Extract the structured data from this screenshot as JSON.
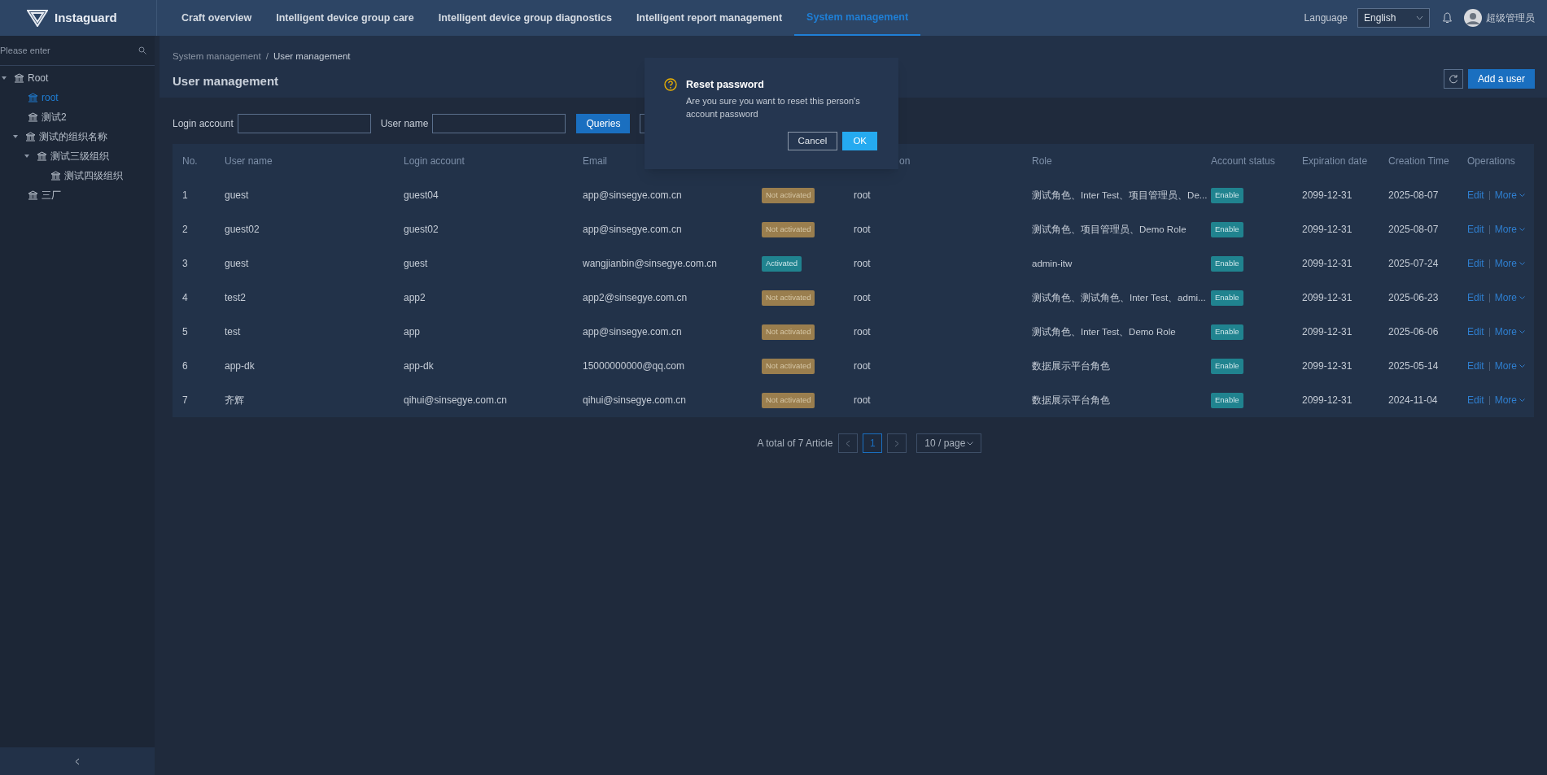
{
  "header": {
    "logo_text": "Instaguard",
    "nav": [
      {
        "label": "Craft overview",
        "selected": false
      },
      {
        "label": "Intelligent device group care",
        "selected": false
      },
      {
        "label": "Intelligent device group diagnostics",
        "selected": false
      },
      {
        "label": "Intelligent report management",
        "selected": false
      },
      {
        "label": "System management",
        "selected": true
      }
    ],
    "language_label": "Language",
    "language": "English",
    "user_name": "超级管理员"
  },
  "sidebar": {
    "search_placeholder": "Please enter",
    "tree": [
      {
        "label": "Root",
        "selected": false,
        "expanded": true,
        "children": [
          {
            "label": "root",
            "selected": true
          },
          {
            "label": "测试2",
            "selected": false
          },
          {
            "label": "测试的组织名称",
            "selected": false,
            "expanded": true,
            "children": [
              {
                "label": "测试三级组织",
                "selected": false,
                "expanded": true,
                "children": [
                  {
                    "label": "测试四级组织",
                    "selected": false
                  }
                ]
              }
            ]
          },
          {
            "label": "三厂",
            "selected": false
          }
        ]
      }
    ]
  },
  "breadcrumb": [
    "System management",
    "User management"
  ],
  "breadcrumb_separator": "/",
  "page_title": "User management",
  "add_button": "Add a user",
  "filters": [
    {
      "label": "Login account"
    },
    {
      "label": "User name"
    }
  ],
  "query_button": "Queries",
  "table": {
    "columns": [
      "No.",
      "User name",
      "Login account",
      "Email",
      "",
      "on",
      "Role",
      "Account status",
      "Expiration date",
      "Creation Time",
      "Operations"
    ],
    "rows": [
      {
        "no": "1",
        "user_name": "guest",
        "login": "guest04",
        "email": "app@sinsegye.com.cn",
        "activation": {
          "label": "Not activated",
          "kind": "inactive"
        },
        "org": "root",
        "role": "测试角色、Inter Test、项目管理员、De...",
        "account_status": "Enable",
        "expires": "2099-12-31",
        "created": "2025-08-07",
        "edit": "Edit",
        "more": "More"
      },
      {
        "no": "2",
        "user_name": "guest02",
        "login": "guest02",
        "email": "app@sinsegye.com.cn",
        "activation": {
          "label": "Not activated",
          "kind": "inactive"
        },
        "org": "root",
        "role": "测试角色、项目管理员、Demo Role",
        "account_status": "Enable",
        "expires": "2099-12-31",
        "created": "2025-08-07",
        "edit": "Edit",
        "more": "More"
      },
      {
        "no": "3",
        "user_name": "guest",
        "login": "guest",
        "email": "wangjianbin@sinsegye.com.cn",
        "activation": {
          "label": "Activated",
          "kind": "active"
        },
        "org": "root",
        "role": "admin-itw",
        "account_status": "Enable",
        "expires": "2099-12-31",
        "created": "2025-07-24",
        "edit": "Edit",
        "more": "More"
      },
      {
        "no": "4",
        "user_name": "test2",
        "login": "app2",
        "email": "app2@sinsegye.com.cn",
        "activation": {
          "label": "Not activated",
          "kind": "inactive"
        },
        "org": "root",
        "role": "测试角色、测试角色、Inter Test、admi...",
        "account_status": "Enable",
        "expires": "2099-12-31",
        "created": "2025-06-23",
        "edit": "Edit",
        "more": "More"
      },
      {
        "no": "5",
        "user_name": "test",
        "login": "app",
        "email": "app@sinsegye.com.cn",
        "activation": {
          "label": "Not activated",
          "kind": "inactive"
        },
        "org": "root",
        "role": "测试角色、Inter Test、Demo Role",
        "account_status": "Enable",
        "expires": "2099-12-31",
        "created": "2025-06-06",
        "edit": "Edit",
        "more": "More"
      },
      {
        "no": "6",
        "user_name": "app-dk",
        "login": "app-dk",
        "email": "15000000000@qq.com",
        "activation": {
          "label": "Not activated",
          "kind": "inactive"
        },
        "org": "root",
        "role": "数据展示平台角色",
        "account_status": "Enable",
        "expires": "2099-12-31",
        "created": "2025-05-14",
        "edit": "Edit",
        "more": "More"
      },
      {
        "no": "7",
        "user_name": "齐辉",
        "login": "qihui@sinsegye.com.cn",
        "email": "qihui@sinsegye.com.cn",
        "activation": {
          "label": "Not activated",
          "kind": "inactive"
        },
        "org": "root",
        "role": "数据展示平台角色",
        "account_status": "Enable",
        "expires": "2099-12-31",
        "created": "2024-11-04",
        "edit": "Edit",
        "more": "More"
      }
    ]
  },
  "pagination": {
    "total": "A total of 7 Article",
    "pages": [
      {
        "label": "1",
        "selected": true
      }
    ],
    "page_size": "10 / page"
  },
  "dialog": {
    "title": "Reset password",
    "message": "Are you sure you want to reset this person's account password",
    "buttons": [
      {
        "label": "Cancel",
        "kind": "secondary"
      },
      {
        "label": "OK",
        "kind": "primary"
      }
    ]
  }
}
